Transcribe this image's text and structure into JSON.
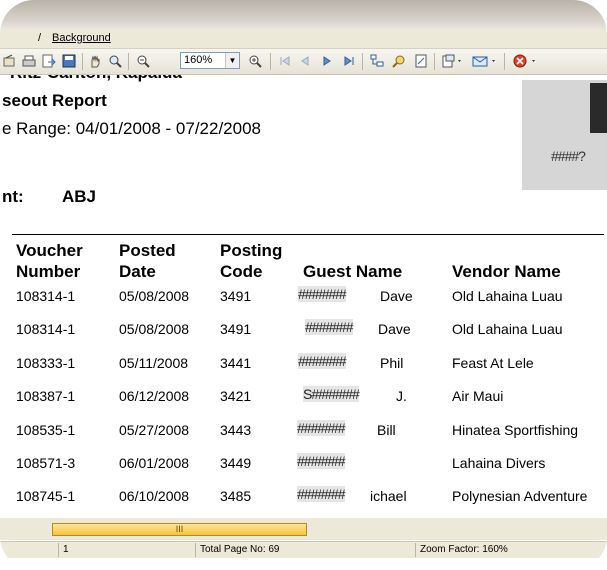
{
  "menu": {
    "background": "Background"
  },
  "toolbar": {
    "zoom_value": "160%"
  },
  "report": {
    "hotel_line": "Ritz-Carlton, Kapalua",
    "title_line": "seout Report",
    "range_line": "e Range: 04/01/2008 - 07/22/2008",
    "agent_label": "nt:",
    "agent_value": "ABJ",
    "logo_mask": "####?",
    "columns": {
      "voucher": [
        "Voucher",
        "Number"
      ],
      "posted": [
        "Posted",
        "Date"
      ],
      "posting": [
        "Posting",
        "Code"
      ],
      "guest": "Guest Name",
      "vendor": "Vendor Name"
    },
    "rows": [
      {
        "voucher": "108314-1",
        "date": "05/08/2008",
        "code": "3491",
        "guest_mask": "#######",
        "guest_tail": "Dave",
        "vendor": "Old Lahaina Luau"
      },
      {
        "voucher": "108314-1",
        "date": "05/08/2008",
        "code": "3491",
        "guest_mask": "#######",
        "guest_tail": "Dave",
        "vendor": "Old Lahaina Luau"
      },
      {
        "voucher": "108333-1",
        "date": "05/11/2008",
        "code": "3441",
        "guest_mask": "#######",
        "guest_tail": "Phil",
        "vendor": "Feast At Lele"
      },
      {
        "voucher": "108387-1",
        "date": "06/12/2008",
        "code": "3421",
        "guest_mask": "S#######",
        "guest_tail": "J.",
        "vendor": "Air Maui"
      },
      {
        "voucher": "108535-1",
        "date": "05/27/2008",
        "code": "3443",
        "guest_mask": "#######",
        "guest_tail": "Bill",
        "vendor": "Hinatea Sportfishing"
      },
      {
        "voucher": "108571-3",
        "date": "06/01/2008",
        "code": "3449",
        "guest_mask": "#######",
        "guest_tail": "",
        "vendor": "Lahaina Divers"
      },
      {
        "voucher": "108745-1",
        "date": "06/10/2008",
        "code": "3485",
        "guest_mask": "#######",
        "guest_tail": "ichael",
        "vendor": "Polynesian Adventure"
      }
    ]
  },
  "scroll": {
    "thumb_grip": "III"
  },
  "status": {
    "page": "1",
    "total_pages": "Total Page No: 69",
    "zoom_factor": "Zoom Factor: 160%"
  },
  "icons": [
    "print-setup-icon",
    "print-icon",
    "export-icon",
    "save-icon",
    "hand-tool-icon",
    "zoom-tool-icon",
    "zoom-out-icon",
    "zoom-in-icon",
    "first-page-icon",
    "prev-page-icon",
    "next-page-icon",
    "last-page-icon",
    "group-tree-icon",
    "search-icon",
    "page-setup-icon",
    "export-menu-icon",
    "email-icon",
    "close-report-icon"
  ],
  "colors": {
    "scroll_thumb": "#f7c23a",
    "selected_tool": "#c7d9f2",
    "stop_button": "#d9412b"
  }
}
